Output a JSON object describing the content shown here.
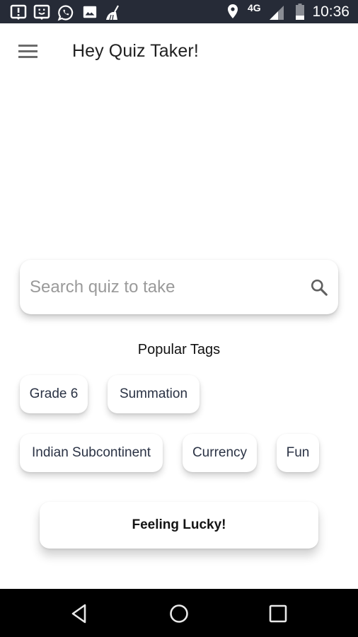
{
  "status_bar": {
    "left_icons": [
      "alert-notification-icon",
      "face-notification-icon",
      "whatsapp-icon",
      "image-icon",
      "cleaner-broom-icon"
    ],
    "location_icon": "location-pin-icon",
    "network": "4G",
    "signal_icon": "signal-icon",
    "battery_icon": "battery-icon",
    "time": "10:36"
  },
  "app_bar": {
    "menu_icon": "hamburger-menu-icon",
    "title": "Hey Quiz Taker!"
  },
  "search": {
    "placeholder": "Search quiz to take",
    "value": "",
    "icon": "search-icon"
  },
  "tags": {
    "heading": "Popular Tags",
    "items": [
      {
        "label": "Grade 6"
      },
      {
        "label": "Summation"
      },
      {
        "label": "Indian Subcontinent"
      },
      {
        "label": "Currency"
      },
      {
        "label": "Fun"
      }
    ]
  },
  "lucky_button": {
    "label": "Feeling Lucky!"
  },
  "nav_bar": {
    "back": "back-icon",
    "home": "home-icon",
    "recents": "recents-icon"
  }
}
